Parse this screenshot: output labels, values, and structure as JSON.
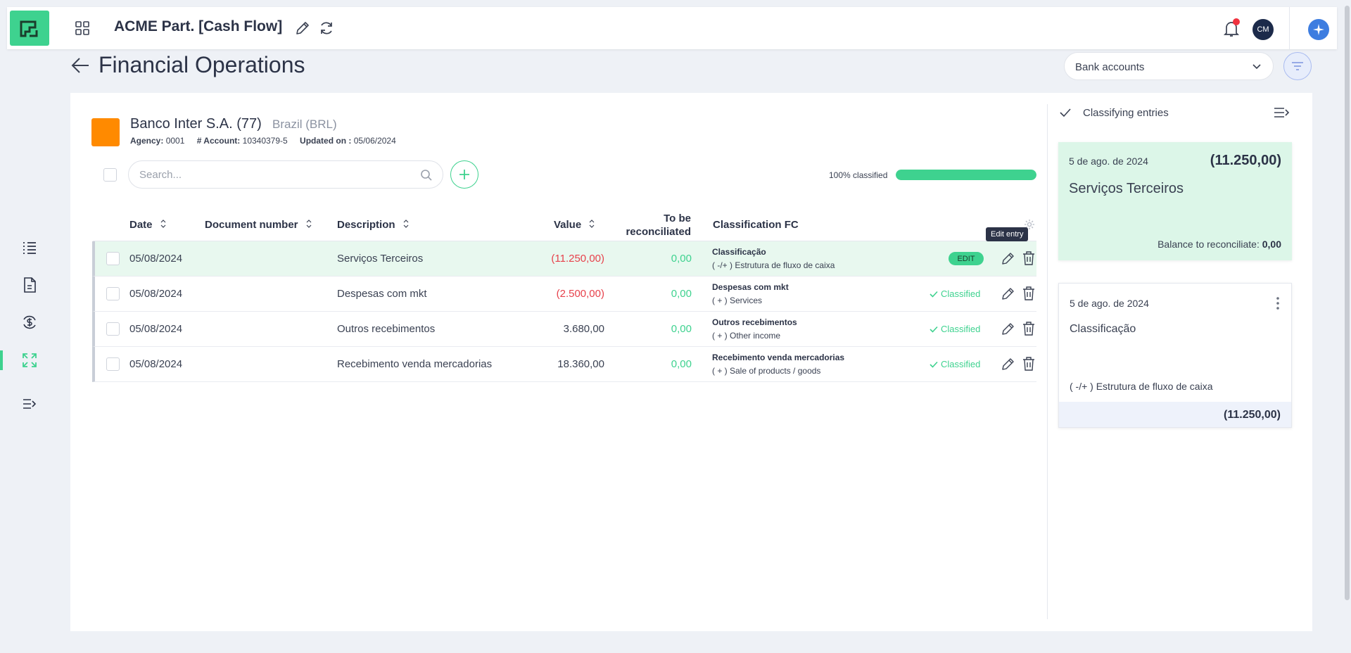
{
  "app": {
    "title": "ACME Part. [Cash Flow]",
    "avatar_initials": "CM",
    "brand_color": "#3ed28f"
  },
  "page": {
    "title": "Financial Operations",
    "bank_select_value": "Bank accounts"
  },
  "bank": {
    "name": "Banco Inter S.A. (77)",
    "country": "Brazil (BRL)",
    "agency_label": "Agency:",
    "agency": "0001",
    "account_label": "# Account:",
    "account": "10340379-5",
    "updated_label": "Updated on :",
    "updated": "05/06/2024",
    "color": "#ff8a00"
  },
  "toolbar": {
    "search_placeholder": "Search...",
    "progress_label": "100% classified",
    "progress": 1.0
  },
  "table": {
    "headers": {
      "date": "Date",
      "document": "Document number",
      "description": "Description",
      "value": "Value",
      "to_reconcile_1": "To be",
      "to_reconcile_2": "reconciliated",
      "classification": "Classification FC"
    },
    "rows": [
      {
        "date": "05/08/2024",
        "document": "",
        "description": "Serviços Terceiros",
        "value": "(11.250,00)",
        "to_reconcile": "0,00",
        "cls_title": "Classificação",
        "cls_sub": "( -/+ ) Estrutura de fluxo de caixa",
        "status": "EDIT"
      },
      {
        "date": "05/08/2024",
        "document": "",
        "description": "Despesas com mkt",
        "value": "(2.500,00)",
        "to_reconcile": "0,00",
        "cls_title": "Despesas com mkt",
        "cls_sub": "( + ) Services",
        "status": "Classified"
      },
      {
        "date": "05/08/2024",
        "document": "",
        "description": "Outros recebimentos",
        "value": "3.680,00",
        "to_reconcile": "0,00",
        "cls_title": "Outros recebimentos",
        "cls_sub": "( + ) Other income",
        "status": "Classified"
      },
      {
        "date": "05/08/2024",
        "document": "",
        "description": "Recebimento venda mercadorias",
        "value": "18.360,00",
        "to_reconcile": "0,00",
        "cls_title": "Recebimento venda mercadorias",
        "cls_sub": "( + ) Sale of products / goods",
        "status": "Classified"
      }
    ],
    "tooltip": "Edit entry"
  },
  "panel": {
    "title": "Classifying entries",
    "entry": {
      "date": "5 de ago. de 2024",
      "amount": "(11.250,00)",
      "description": "Serviços Terceiros",
      "balance_label": "Balance to reconciliate:",
      "balance": "0,00"
    },
    "classification": {
      "date": "5 de ago. de 2024",
      "title": "Classificação",
      "subtitle": "( -/+ ) Estrutura de fluxo de caixa",
      "amount": "(11.250,00)"
    }
  }
}
